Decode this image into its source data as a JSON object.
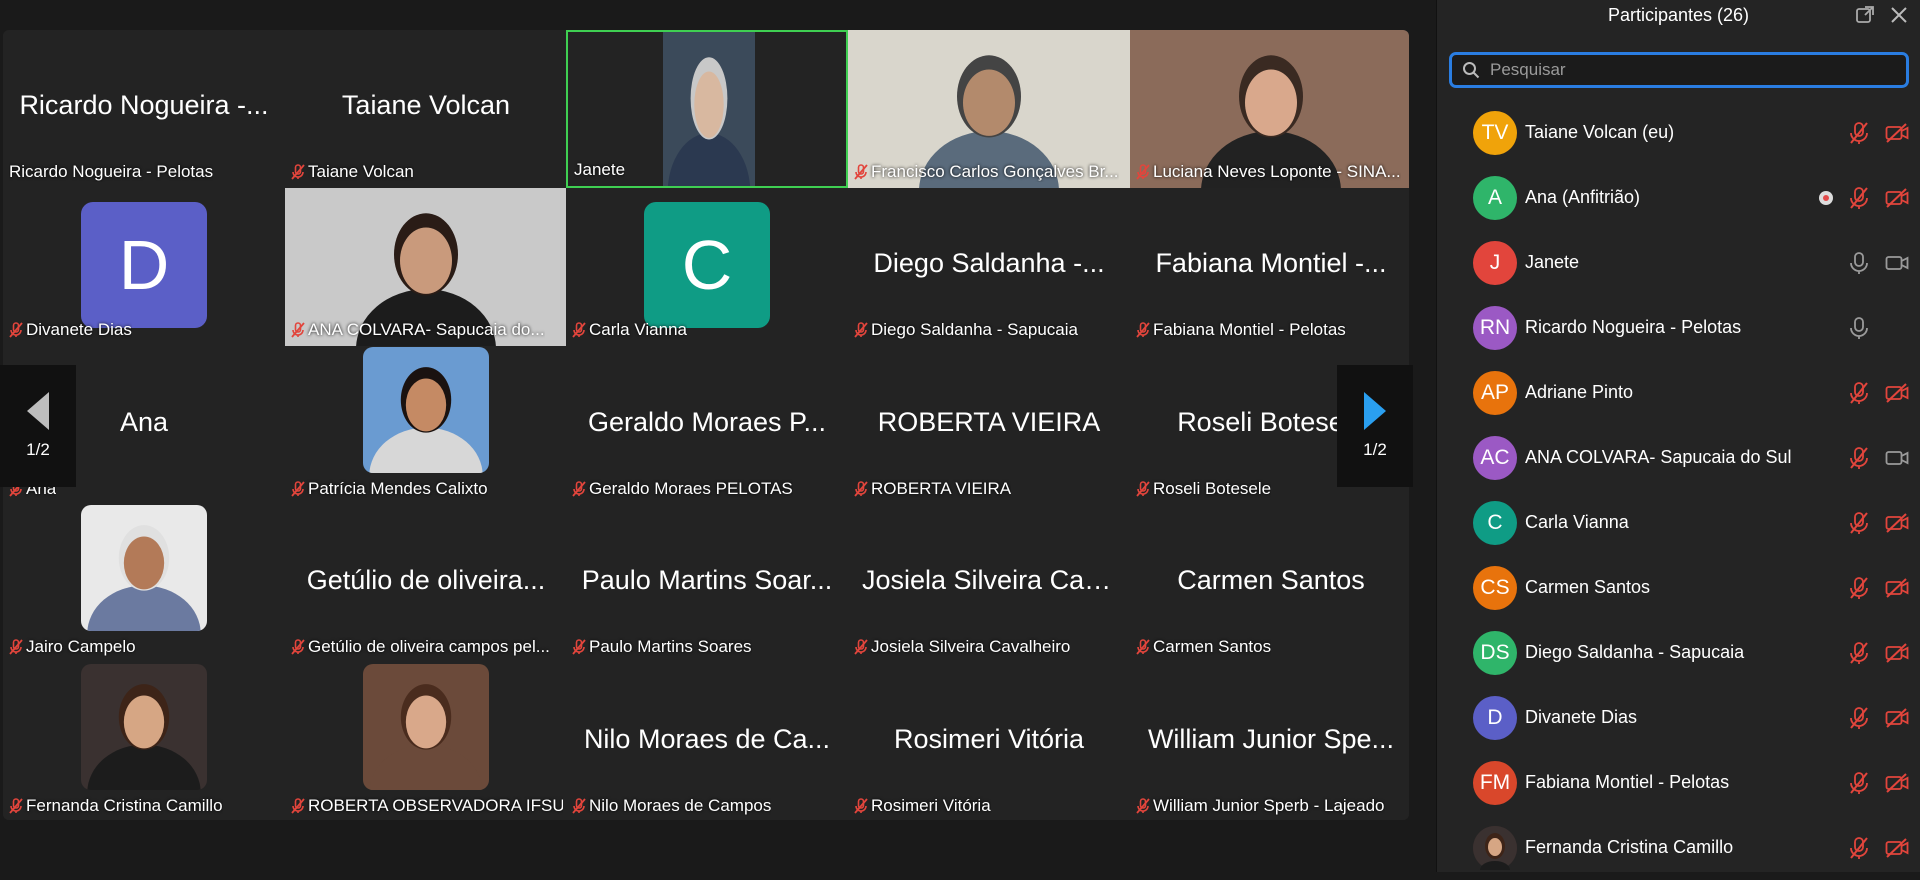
{
  "colors": {
    "accent_blue": "#2a7de1",
    "active_border": "#3fcf52",
    "muted_red": "#e2453c",
    "panel_bg": "#242424"
  },
  "gallery": {
    "page_indicator_left": "1/2",
    "page_indicator_right": "1/2",
    "tiles": [
      {
        "big": "Ricardo Nogueira -...",
        "label": "Ricardo Nogueira - Pelotas",
        "muted": false
      },
      {
        "big": "Taiane Volcan",
        "label": "Taiane Volcan",
        "muted": true
      },
      {
        "big": "",
        "label": "Janete",
        "muted": false
      },
      {
        "big": "",
        "label": "Francisco Carlos Gonçalves Br...",
        "muted": true
      },
      {
        "big": "",
        "label": "Luciana Neves Loponte - SINA...",
        "muted": true
      },
      {
        "big": "",
        "label": "Divanete Dias",
        "muted": true,
        "avatar": "D"
      },
      {
        "big": "",
        "label": "ANA  COLVARA- Sapucaia do...",
        "muted": true
      },
      {
        "big": "",
        "label": "Carla Vianna",
        "muted": true,
        "avatar": "C"
      },
      {
        "big": "Diego Saldanha -...",
        "label": "Diego Saldanha - Sapucaia",
        "muted": true
      },
      {
        "big": "Fabiana Montiel -...",
        "label": "Fabiana Montiel - Pelotas",
        "muted": true
      },
      {
        "big": "Ana",
        "label": "Ana",
        "muted": true
      },
      {
        "big": "",
        "label": "Patrícia Mendes Calixto",
        "muted": true
      },
      {
        "big": "Geraldo Moraes P...",
        "label": "Geraldo Moraes PELOTAS",
        "muted": true
      },
      {
        "big": "ROBERTA VIEIRA",
        "label": "ROBERTA VIEIRA",
        "muted": true
      },
      {
        "big": "Roseli Botesele",
        "label": "Roseli Botesele",
        "muted": true
      },
      {
        "big": "",
        "label": "Jairo Campelo",
        "muted": true
      },
      {
        "big": "Getúlio de oliveira...",
        "label": "Getúlio de oliveira campos pel...",
        "muted": true
      },
      {
        "big": "Paulo Martins Soar...",
        "label": "Paulo Martins Soares",
        "muted": true
      },
      {
        "big": "Josiela Silveira Cav...",
        "label": "Josiela Silveira Cavalheiro",
        "muted": true
      },
      {
        "big": "Carmen Santos",
        "label": "Carmen Santos",
        "muted": true
      },
      {
        "big": "",
        "label": "Fernanda Cristina Camillo",
        "muted": true
      },
      {
        "big": "",
        "label": "ROBERTA OBSERVADORA IFSUL",
        "muted": true
      },
      {
        "big": "Nilo Moraes de Ca...",
        "label": "Nilo Moraes de Campos",
        "muted": true
      },
      {
        "big": "Rosimeri Vitória",
        "label": "Rosimeri Vitória",
        "muted": true
      },
      {
        "big": "William Junior Spe...",
        "label": "William Junior Sperb - Lajeado",
        "muted": true
      }
    ]
  },
  "panel": {
    "title": "Participantes (26)",
    "search_placeholder": "Pesquisar",
    "participants": [
      {
        "initials": "TV",
        "name": "Taiane Volcan (eu)",
        "color": "#f0a30a",
        "mic": "muted",
        "cam": "off"
      },
      {
        "initials": "A",
        "name": "Ana (Anfitrião)",
        "color": "#2fb56a",
        "mic": "muted",
        "cam": "off",
        "rec": true
      },
      {
        "initials": "J",
        "name": "Janete",
        "color": "#e2453c",
        "mic": "on",
        "cam": "on"
      },
      {
        "initials": "RN",
        "name": "Ricardo Nogueira - Pelotas",
        "color": "#9b59c4",
        "mic": "on",
        "cam": "none"
      },
      {
        "initials": "AP",
        "name": "Adriane Pinto",
        "color": "#e8730c",
        "mic": "muted",
        "cam": "off"
      },
      {
        "initials": "AC",
        "name": "ANA  COLVARA- Sapucaia do Sul",
        "color": "#9b59c4",
        "mic": "muted",
        "cam": "on"
      },
      {
        "initials": "C",
        "name": "Carla Vianna",
        "color": "#0f9c85",
        "mic": "muted",
        "cam": "off"
      },
      {
        "initials": "CS",
        "name": "Carmen Santos",
        "color": "#e8730c",
        "mic": "muted",
        "cam": "off"
      },
      {
        "initials": "DS",
        "name": "Diego Saldanha - Sapucaia",
        "color": "#2fb56a",
        "mic": "muted",
        "cam": "off"
      },
      {
        "initials": "D",
        "name": "Divanete Dias",
        "color": "#5b5fc7",
        "mic": "muted",
        "cam": "off"
      },
      {
        "initials": "FM",
        "name": "Fabiana Montiel - Pelotas",
        "color": "#d9472b",
        "mic": "muted",
        "cam": "off"
      },
      {
        "initials": "",
        "name": "Fernanda Cristina Camillo",
        "color": "#3a2a2a",
        "mic": "muted",
        "cam": "off",
        "photo": true
      }
    ]
  }
}
